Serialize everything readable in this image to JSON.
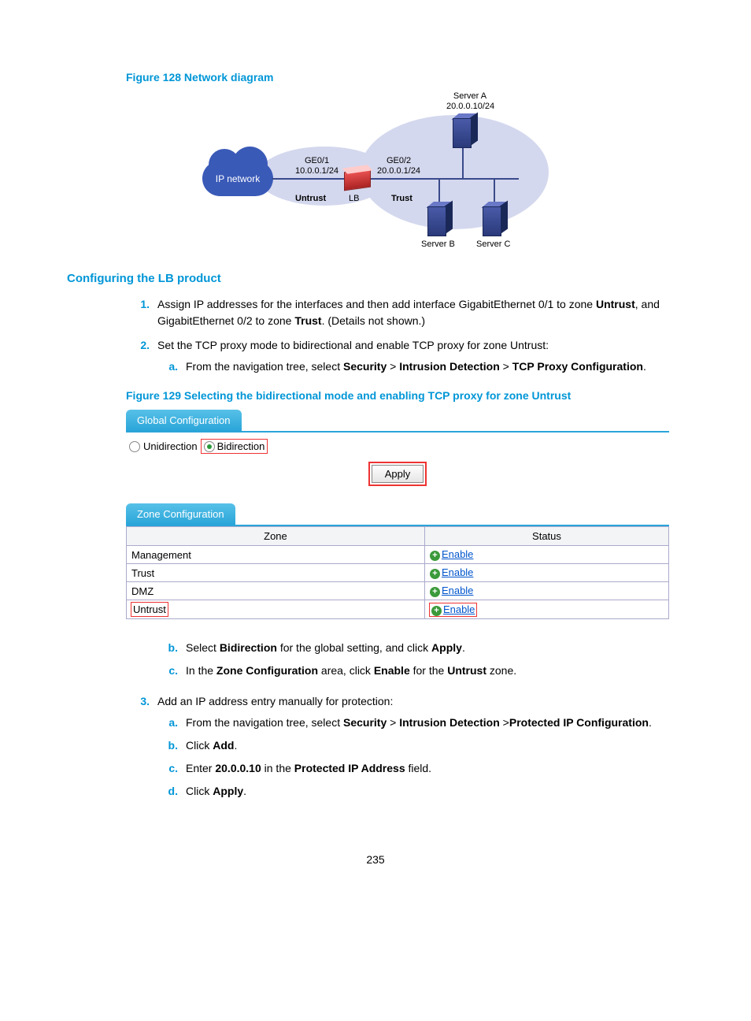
{
  "figure128_title": "Figure 128 Network diagram",
  "diagram": {
    "cloud": "IP network",
    "ge01": "GE0/1",
    "ge01_ip": "10.0.0.1/24",
    "ge02": "GE0/2",
    "ge02_ip": "20.0.0.1/24",
    "untrust": "Untrust",
    "lb": "LB",
    "trust": "Trust",
    "serverA": "Server A",
    "serverA_ip": "20.0.0.10/24",
    "serverB": "Server B",
    "serverC": "Server C"
  },
  "section_title": "Configuring the LB product",
  "step1_pre": "Assign IP addresses for the interfaces and then add interface GigabitEthernet 0/1 to zone ",
  "step1_b1": "Untrust",
  "step1_mid": ", and GigabitEthernet 0/2 to zone ",
  "step1_b2": "Trust",
  "step1_post": ". (Details not shown.)",
  "step2": "Set the TCP proxy mode to bidirectional and enable TCP proxy for zone Untrust:",
  "step2a_pre": "From the navigation tree, select ",
  "nav_security": "Security",
  "nav_id": "Intrusion Detection",
  "nav_tcp": "TCP Proxy Configuration",
  "figure129_title": "Figure 129 Selecting the bidirectional mode and enabling TCP proxy for zone Untrust",
  "ui": {
    "global_tab": "Global Configuration",
    "unidirection": "Unidirection",
    "bidirection": "Bidirection",
    "apply": "Apply",
    "zone_tab": "Zone Configuration",
    "col_zone": "Zone",
    "col_status": "Status",
    "rows": [
      {
        "zone": "Management",
        "status": "Enable"
      },
      {
        "zone": "Trust",
        "status": "Enable"
      },
      {
        "zone": "DMZ",
        "status": "Enable"
      },
      {
        "zone": "Untrust",
        "status": "Enable"
      }
    ]
  },
  "step2b_pre": "Select ",
  "step2b_b1": "Bidirection",
  "step2b_mid": " for the global setting, and click ",
  "step2b_b2": "Apply",
  "step2c_pre": "In the ",
  "step2c_b1": "Zone Configuration",
  "step2c_mid": " area, click ",
  "step2c_b2": "Enable",
  "step2c_mid2": " for the ",
  "step2c_b3": "Untrust",
  "step2c_post": " zone.",
  "step3": "Add an IP address entry manually for protection:",
  "step3a_pre": "From the navigation tree, select ",
  "nav_pip": "Protected IP Configuration",
  "step3b_pre": "Click ",
  "step3b_b": "Add",
  "step3c_pre": "Enter ",
  "step3c_b1": "20.0.0.10",
  "step3c_mid": " in the ",
  "step3c_b2": "Protected IP Address",
  "step3c_post": " field.",
  "step3d_pre": "Click ",
  "step3d_b": "Apply",
  "page_number": "235"
}
